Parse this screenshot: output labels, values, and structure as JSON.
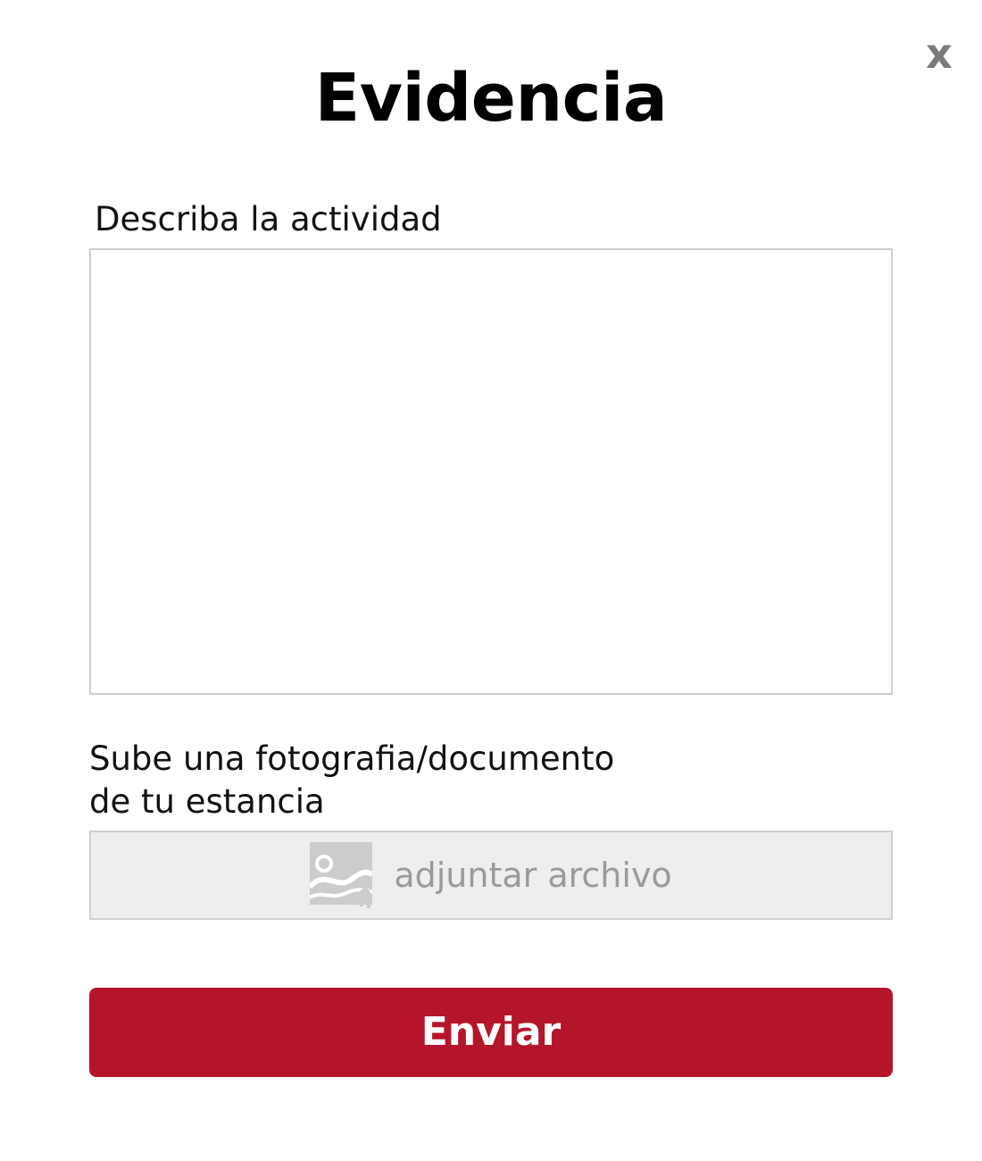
{
  "dialog": {
    "title": "Evidencia",
    "close_label": "x"
  },
  "description": {
    "label": "Describa la actividad",
    "value": "",
    "placeholder": ""
  },
  "upload": {
    "label_line1": "Sube una fotografia/documento",
    "label_line2": "de tu estancia",
    "button_text": "adjuntar archivo",
    "icon": "image-icon"
  },
  "submit": {
    "label": "Enviar"
  },
  "colors": {
    "accent": "#b5152b",
    "border": "#cfcfcf",
    "attach_bg": "#eeeeee",
    "muted_text": "#9a9a9a"
  }
}
